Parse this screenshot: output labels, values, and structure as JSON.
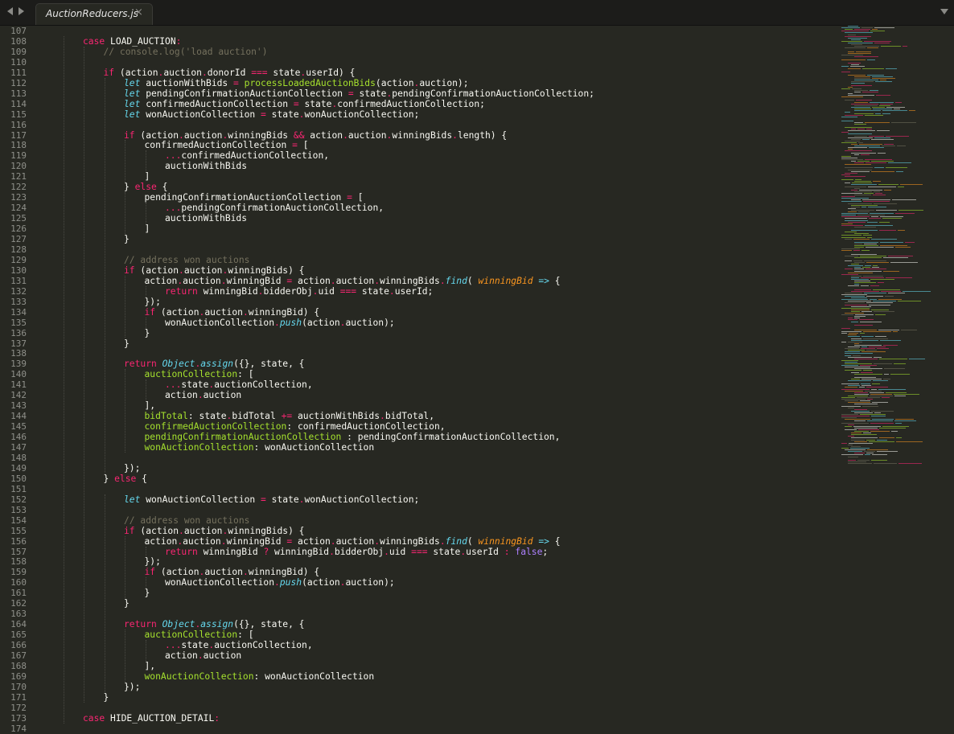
{
  "tab": {
    "title": "AuctionReducers.js",
    "close": "×"
  },
  "colors": {
    "background": "#272822",
    "keyword": "#f92672",
    "storage": "#66d9ef",
    "function": "#a6e22e",
    "comment": "#75715e",
    "param": "#fd971f",
    "constant": "#ae81ff",
    "text": "#f8f8f2"
  },
  "icons": [
    "back-arrow-icon",
    "forward-arrow-icon",
    "close-icon",
    "tab-menu-icon"
  ],
  "lines": [
    {
      "n": "107",
      "ind": 0,
      "toks": []
    },
    {
      "n": "108",
      "ind": 2,
      "toks": [
        {
          "t": "case",
          "c": "kw"
        },
        {
          "t": " LOAD_AUCTION"
        },
        {
          "t": ":",
          "c": "kw"
        }
      ]
    },
    {
      "n": "109",
      "ind": 3,
      "toks": [
        {
          "t": "// console.log('load auction')",
          "c": "cm"
        }
      ]
    },
    {
      "n": "110",
      "ind": 0,
      "toks": []
    },
    {
      "n": "111",
      "ind": 3,
      "toks": [
        {
          "t": "if",
          "c": "kw"
        },
        {
          "t": " (action"
        },
        {
          "t": ".",
          "c": "kw"
        },
        {
          "t": "auction"
        },
        {
          "t": ".",
          "c": "kw"
        },
        {
          "t": "donorId "
        },
        {
          "t": "===",
          "c": "kw"
        },
        {
          "t": " state"
        },
        {
          "t": ".",
          "c": "kw"
        },
        {
          "t": "userId) {"
        }
      ]
    },
    {
      "n": "112",
      "ind": 4,
      "toks": [
        {
          "t": "let",
          "c": "st"
        },
        {
          "t": " auctionWithBids "
        },
        {
          "t": "=",
          "c": "kw"
        },
        {
          "t": " "
        },
        {
          "t": "processLoadedAuctionBids",
          "c": "fn"
        },
        {
          "t": "(action"
        },
        {
          "t": ".",
          "c": "kw"
        },
        {
          "t": "auction);"
        }
      ]
    },
    {
      "n": "113",
      "ind": 4,
      "toks": [
        {
          "t": "let",
          "c": "st"
        },
        {
          "t": " pendingConfirmationAuctionCollection "
        },
        {
          "t": "=",
          "c": "kw"
        },
        {
          "t": " state"
        },
        {
          "t": ".",
          "c": "kw"
        },
        {
          "t": "pendingConfirmationAuctionCollection;"
        }
      ]
    },
    {
      "n": "114",
      "ind": 4,
      "toks": [
        {
          "t": "let",
          "c": "st"
        },
        {
          "t": " confirmedAuctionCollection "
        },
        {
          "t": "=",
          "c": "kw"
        },
        {
          "t": " state"
        },
        {
          "t": ".",
          "c": "kw"
        },
        {
          "t": "confirmedAuctionCollection;"
        }
      ]
    },
    {
      "n": "115",
      "ind": 4,
      "toks": [
        {
          "t": "let",
          "c": "st"
        },
        {
          "t": " wonAuctionCollection "
        },
        {
          "t": "=",
          "c": "kw"
        },
        {
          "t": " state"
        },
        {
          "t": ".",
          "c": "kw"
        },
        {
          "t": "wonAuctionCollection;"
        }
      ]
    },
    {
      "n": "116",
      "ind": 0,
      "toks": []
    },
    {
      "n": "117",
      "ind": 4,
      "toks": [
        {
          "t": "if",
          "c": "kw"
        },
        {
          "t": " (action"
        },
        {
          "t": ".",
          "c": "kw"
        },
        {
          "t": "auction"
        },
        {
          "t": ".",
          "c": "kw"
        },
        {
          "t": "winningBids "
        },
        {
          "t": "&&",
          "c": "kw"
        },
        {
          "t": " action"
        },
        {
          "t": ".",
          "c": "kw"
        },
        {
          "t": "auction"
        },
        {
          "t": ".",
          "c": "kw"
        },
        {
          "t": "winningBids"
        },
        {
          "t": ".",
          "c": "kw"
        },
        {
          "t": "length) {"
        }
      ]
    },
    {
      "n": "118",
      "ind": 5,
      "toks": [
        {
          "t": "confirmedAuctionCollection "
        },
        {
          "t": "=",
          "c": "kw"
        },
        {
          "t": " ["
        }
      ]
    },
    {
      "n": "119",
      "ind": 6,
      "toks": [
        {
          "t": "...",
          "c": "kw"
        },
        {
          "t": "confirmedAuctionCollection,"
        }
      ]
    },
    {
      "n": "120",
      "ind": 6,
      "toks": [
        {
          "t": "auctionWithBids"
        }
      ]
    },
    {
      "n": "121",
      "ind": 5,
      "toks": [
        {
          "t": "]"
        }
      ]
    },
    {
      "n": "122",
      "ind": 4,
      "toks": [
        {
          "t": "} "
        },
        {
          "t": "else",
          "c": "kw"
        },
        {
          "t": " {"
        }
      ]
    },
    {
      "n": "123",
      "ind": 5,
      "toks": [
        {
          "t": "pendingConfirmationAuctionCollection "
        },
        {
          "t": "=",
          "c": "kw"
        },
        {
          "t": " ["
        }
      ]
    },
    {
      "n": "124",
      "ind": 6,
      "toks": [
        {
          "t": "...",
          "c": "kw"
        },
        {
          "t": "pendingConfirmationAuctionCollection,"
        }
      ]
    },
    {
      "n": "125",
      "ind": 6,
      "toks": [
        {
          "t": "auctionWithBids"
        }
      ]
    },
    {
      "n": "126",
      "ind": 5,
      "toks": [
        {
          "t": "]"
        }
      ]
    },
    {
      "n": "127",
      "ind": 4,
      "toks": [
        {
          "t": "}"
        }
      ]
    },
    {
      "n": "128",
      "ind": 0,
      "toks": []
    },
    {
      "n": "129",
      "ind": 4,
      "toks": [
        {
          "t": "// address won auctions",
          "c": "cm"
        }
      ]
    },
    {
      "n": "130",
      "ind": 4,
      "toks": [
        {
          "t": "if",
          "c": "kw"
        },
        {
          "t": " (action"
        },
        {
          "t": ".",
          "c": "kw"
        },
        {
          "t": "auction"
        },
        {
          "t": ".",
          "c": "kw"
        },
        {
          "t": "winningBids) {"
        }
      ]
    },
    {
      "n": "131",
      "ind": 5,
      "toks": [
        {
          "t": "action"
        },
        {
          "t": ".",
          "c": "kw"
        },
        {
          "t": "auction"
        },
        {
          "t": ".",
          "c": "kw"
        },
        {
          "t": "winningBid "
        },
        {
          "t": "=",
          "c": "kw"
        },
        {
          "t": " action"
        },
        {
          "t": ".",
          "c": "kw"
        },
        {
          "t": "auction"
        },
        {
          "t": ".",
          "c": "kw"
        },
        {
          "t": "winningBids"
        },
        {
          "t": ".",
          "c": "kw"
        },
        {
          "t": "find",
          "c": "st"
        },
        {
          "t": "( "
        },
        {
          "t": "winningBid",
          "c": "pa"
        },
        {
          "t": " "
        },
        {
          "t": "=>",
          "c": "st"
        },
        {
          "t": " {"
        }
      ]
    },
    {
      "n": "132",
      "ind": 6,
      "toks": [
        {
          "t": "return",
          "c": "kw"
        },
        {
          "t": " winningBid"
        },
        {
          "t": ".",
          "c": "kw"
        },
        {
          "t": "bidderObj"
        },
        {
          "t": ".",
          "c": "kw"
        },
        {
          "t": "uid "
        },
        {
          "t": "===",
          "c": "kw"
        },
        {
          "t": " state"
        },
        {
          "t": ".",
          "c": "kw"
        },
        {
          "t": "userId;"
        }
      ]
    },
    {
      "n": "133",
      "ind": 5,
      "toks": [
        {
          "t": "});"
        }
      ]
    },
    {
      "n": "134",
      "ind": 5,
      "toks": [
        {
          "t": "if",
          "c": "kw"
        },
        {
          "t": " (action"
        },
        {
          "t": ".",
          "c": "kw"
        },
        {
          "t": "auction"
        },
        {
          "t": ".",
          "c": "kw"
        },
        {
          "t": "winningBid) {"
        }
      ]
    },
    {
      "n": "135",
      "ind": 6,
      "toks": [
        {
          "t": "wonAuctionCollection"
        },
        {
          "t": ".",
          "c": "kw"
        },
        {
          "t": "push",
          "c": "st"
        },
        {
          "t": "(action"
        },
        {
          "t": ".",
          "c": "kw"
        },
        {
          "t": "auction);"
        }
      ]
    },
    {
      "n": "136",
      "ind": 5,
      "toks": [
        {
          "t": "}"
        }
      ]
    },
    {
      "n": "137",
      "ind": 4,
      "toks": [
        {
          "t": "}"
        }
      ]
    },
    {
      "n": "138",
      "ind": 0,
      "toks": []
    },
    {
      "n": "139",
      "ind": 4,
      "toks": [
        {
          "t": "return",
          "c": "kw"
        },
        {
          "t": " "
        },
        {
          "t": "Object",
          "c": "st"
        },
        {
          "t": ".",
          "c": "kw"
        },
        {
          "t": "assign",
          "c": "st"
        },
        {
          "t": "({}, state, {"
        }
      ]
    },
    {
      "n": "140",
      "ind": 5,
      "toks": [
        {
          "t": "auctionCollection",
          "c": "pr"
        },
        {
          "t": ": ["
        }
      ]
    },
    {
      "n": "141",
      "ind": 6,
      "toks": [
        {
          "t": "...",
          "c": "kw"
        },
        {
          "t": "state"
        },
        {
          "t": ".",
          "c": "kw"
        },
        {
          "t": "auctionCollection,"
        }
      ]
    },
    {
      "n": "142",
      "ind": 6,
      "toks": [
        {
          "t": "action"
        },
        {
          "t": ".",
          "c": "kw"
        },
        {
          "t": "auction"
        }
      ]
    },
    {
      "n": "143",
      "ind": 5,
      "toks": [
        {
          "t": "],"
        }
      ]
    },
    {
      "n": "144",
      "ind": 5,
      "toks": [
        {
          "t": "bidTotal",
          "c": "pr"
        },
        {
          "t": ": state"
        },
        {
          "t": ".",
          "c": "kw"
        },
        {
          "t": "bidTotal "
        },
        {
          "t": "+=",
          "c": "kw"
        },
        {
          "t": " auctionWithBids"
        },
        {
          "t": ".",
          "c": "kw"
        },
        {
          "t": "bidTotal,"
        }
      ]
    },
    {
      "n": "145",
      "ind": 5,
      "toks": [
        {
          "t": "confirmedAuctionCollection",
          "c": "pr"
        },
        {
          "t": ": confirmedAuctionCollection,"
        }
      ]
    },
    {
      "n": "146",
      "ind": 5,
      "toks": [
        {
          "t": "pendingConfirmationAuctionCollection",
          "c": "pr"
        },
        {
          "t": " : pendingConfirmationAuctionCollection,"
        }
      ]
    },
    {
      "n": "147",
      "ind": 5,
      "toks": [
        {
          "t": "wonAuctionCollection",
          "c": "pr"
        },
        {
          "t": ": wonAuctionCollection"
        }
      ]
    },
    {
      "n": "148",
      "ind": 0,
      "toks": []
    },
    {
      "n": "149",
      "ind": 4,
      "toks": [
        {
          "t": "});"
        }
      ]
    },
    {
      "n": "150",
      "ind": 3,
      "toks": [
        {
          "t": "} "
        },
        {
          "t": "else",
          "c": "kw"
        },
        {
          "t": " {"
        }
      ]
    },
    {
      "n": "151",
      "ind": 0,
      "toks": []
    },
    {
      "n": "152",
      "ind": 4,
      "toks": [
        {
          "t": "let",
          "c": "st"
        },
        {
          "t": " wonAuctionCollection "
        },
        {
          "t": "=",
          "c": "kw"
        },
        {
          "t": " state"
        },
        {
          "t": ".",
          "c": "kw"
        },
        {
          "t": "wonAuctionCollection;"
        }
      ]
    },
    {
      "n": "153",
      "ind": 0,
      "toks": []
    },
    {
      "n": "154",
      "ind": 4,
      "toks": [
        {
          "t": "// address won auctions",
          "c": "cm"
        }
      ]
    },
    {
      "n": "155",
      "ind": 4,
      "toks": [
        {
          "t": "if",
          "c": "kw"
        },
        {
          "t": " (action"
        },
        {
          "t": ".",
          "c": "kw"
        },
        {
          "t": "auction"
        },
        {
          "t": ".",
          "c": "kw"
        },
        {
          "t": "winningBids) {"
        }
      ]
    },
    {
      "n": "156",
      "ind": 5,
      "toks": [
        {
          "t": "action"
        },
        {
          "t": ".",
          "c": "kw"
        },
        {
          "t": "auction"
        },
        {
          "t": ".",
          "c": "kw"
        },
        {
          "t": "winningBid "
        },
        {
          "t": "=",
          "c": "kw"
        },
        {
          "t": " action"
        },
        {
          "t": ".",
          "c": "kw"
        },
        {
          "t": "auction"
        },
        {
          "t": ".",
          "c": "kw"
        },
        {
          "t": "winningBids"
        },
        {
          "t": ".",
          "c": "kw"
        },
        {
          "t": "find",
          "c": "st"
        },
        {
          "t": "( "
        },
        {
          "t": "winningBid",
          "c": "pa"
        },
        {
          "t": " "
        },
        {
          "t": "=>",
          "c": "st"
        },
        {
          "t": " {"
        }
      ]
    },
    {
      "n": "157",
      "ind": 6,
      "toks": [
        {
          "t": "return",
          "c": "kw"
        },
        {
          "t": " winningBid "
        },
        {
          "t": "?",
          "c": "kw"
        },
        {
          "t": " winningBid"
        },
        {
          "t": ".",
          "c": "kw"
        },
        {
          "t": "bidderObj"
        },
        {
          "t": ".",
          "c": "kw"
        },
        {
          "t": "uid "
        },
        {
          "t": "===",
          "c": "kw"
        },
        {
          "t": " state"
        },
        {
          "t": ".",
          "c": "kw"
        },
        {
          "t": "userId "
        },
        {
          "t": ":",
          "c": "kw"
        },
        {
          "t": " "
        },
        {
          "t": "false",
          "c": "co"
        },
        {
          "t": ";"
        }
      ]
    },
    {
      "n": "158",
      "ind": 5,
      "toks": [
        {
          "t": "});"
        }
      ]
    },
    {
      "n": "159",
      "ind": 5,
      "toks": [
        {
          "t": "if",
          "c": "kw"
        },
        {
          "t": " (action"
        },
        {
          "t": ".",
          "c": "kw"
        },
        {
          "t": "auction"
        },
        {
          "t": ".",
          "c": "kw"
        },
        {
          "t": "winningBid) {"
        }
      ]
    },
    {
      "n": "160",
      "ind": 6,
      "toks": [
        {
          "t": "wonAuctionCollection"
        },
        {
          "t": ".",
          "c": "kw"
        },
        {
          "t": "push",
          "c": "st"
        },
        {
          "t": "(action"
        },
        {
          "t": ".",
          "c": "kw"
        },
        {
          "t": "auction);"
        }
      ]
    },
    {
      "n": "161",
      "ind": 5,
      "toks": [
        {
          "t": "}"
        }
      ]
    },
    {
      "n": "162",
      "ind": 4,
      "toks": [
        {
          "t": "}"
        }
      ]
    },
    {
      "n": "163",
      "ind": 0,
      "toks": []
    },
    {
      "n": "164",
      "ind": 4,
      "toks": [
        {
          "t": "return",
          "c": "kw"
        },
        {
          "t": " "
        },
        {
          "t": "Object",
          "c": "st"
        },
        {
          "t": ".",
          "c": "kw"
        },
        {
          "t": "assign",
          "c": "st"
        },
        {
          "t": "({}, state, {"
        }
      ]
    },
    {
      "n": "165",
      "ind": 5,
      "toks": [
        {
          "t": "auctionCollection",
          "c": "pr"
        },
        {
          "t": ": ["
        }
      ]
    },
    {
      "n": "166",
      "ind": 6,
      "toks": [
        {
          "t": "...",
          "c": "kw"
        },
        {
          "t": "state"
        },
        {
          "t": ".",
          "c": "kw"
        },
        {
          "t": "auctionCollection,"
        }
      ]
    },
    {
      "n": "167",
      "ind": 6,
      "toks": [
        {
          "t": "action"
        },
        {
          "t": ".",
          "c": "kw"
        },
        {
          "t": "auction"
        }
      ]
    },
    {
      "n": "168",
      "ind": 5,
      "toks": [
        {
          "t": "],"
        }
      ]
    },
    {
      "n": "169",
      "ind": 5,
      "toks": [
        {
          "t": "wonAuctionCollection",
          "c": "pr"
        },
        {
          "t": ": wonAuctionCollection"
        }
      ]
    },
    {
      "n": "170",
      "ind": 4,
      "toks": [
        {
          "t": "});"
        }
      ]
    },
    {
      "n": "171",
      "ind": 3,
      "toks": [
        {
          "t": "}"
        }
      ]
    },
    {
      "n": "172",
      "ind": 0,
      "toks": []
    },
    {
      "n": "173",
      "ind": 2,
      "toks": [
        {
          "t": "case",
          "c": "kw"
        },
        {
          "t": " HIDE_AUCTION_DETAIL"
        },
        {
          "t": ":",
          "c": "kw"
        }
      ]
    },
    {
      "n": "174",
      "ind": 0,
      "toks": []
    }
  ]
}
